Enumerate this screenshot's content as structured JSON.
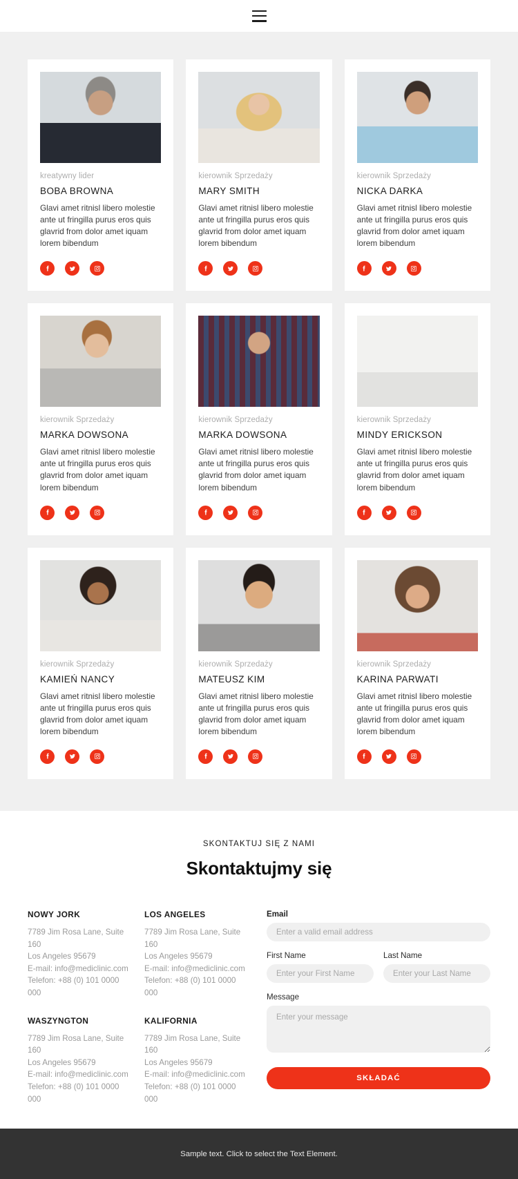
{
  "header": {
    "menu_icon": "hamburger-icon"
  },
  "team": {
    "members": [
      {
        "role": "kreatywny lider",
        "name": "BOBA BROWNA",
        "desc": "Glavi amet ritnisl libero molestie ante ut fringilla purus eros quis glavrid from dolor amet iquam lorem bibendum",
        "photo": "man-gray-hair-suit"
      },
      {
        "role": "kierownik Sprzedaży",
        "name": "MARY SMITH",
        "desc": "Glavi amet ritnisl libero molestie ante ut fringilla purus eros quis glavrid from dolor amet iquam lorem bibendum",
        "photo": "blonde-woman-smiling"
      },
      {
        "role": "kierownik Sprzedaży",
        "name": "NICKA DARKA",
        "desc": "Glavi amet ritnisl libero molestie ante ut fringilla purus eros quis glavrid from dolor amet iquam lorem bibendum",
        "photo": "bearded-man-blue-shirt"
      },
      {
        "role": "kierownik Sprzedaży",
        "name": "MARKA DOWSONA",
        "desc": "Glavi amet ritnisl libero molestie ante ut fringilla purus eros quis glavrid from dolor amet iquam lorem bibendum",
        "photo": "young-man-gray-hoodie"
      },
      {
        "role": "kierownik Sprzedaży",
        "name": "MARKA DOWSONA",
        "desc": "Glavi amet ritnisl libero molestie ante ut fringilla purus eros quis glavrid from dolor amet iquam lorem bibendum",
        "photo": "man-striped-shirt"
      },
      {
        "role": "kierownik Sprzedaży",
        "name": "MINDY ERICKSON",
        "desc": "Glavi amet ritnisl libero molestie ante ut fringilla purus eros quis glavrid from dolor amet iquam lorem bibendum",
        "photo": "woman-at-desk-office"
      },
      {
        "role": "kierownik Sprzedaży",
        "name": "KAMIEŃ NANCY",
        "desc": "Glavi amet ritnisl libero molestie ante ut fringilla purus eros quis glavrid from dolor amet iquam lorem bibendum",
        "photo": "curly-hair-woman-glasses"
      },
      {
        "role": "kierownik Sprzedaży",
        "name": "MATEUSZ KIM",
        "desc": "Glavi amet ritnisl libero molestie ante ut fringilla purus eros quis glavrid from dolor amet iquam lorem bibendum",
        "photo": "laughing-man-gray-shirt"
      },
      {
        "role": "kierownik Sprzedaży",
        "name": "KARINA PARWATI",
        "desc": "Glavi amet ritnisl libero molestie ante ut fringilla purus eros quis glavrid from dolor amet iquam lorem bibendum",
        "photo": "freckled-woman-brown-hair"
      }
    ],
    "social_labels": {
      "facebook": "facebook-icon",
      "twitter": "twitter-icon",
      "instagram": "instagram-icon"
    }
  },
  "contact": {
    "eyebrow": "SKONTAKTUJ SIĘ Z NAMI",
    "title": "Skontaktujmy się",
    "offices": [
      {
        "city": "NOWY JORK",
        "street": "7789 Jim Rosa Lane, Suite 160",
        "city_zip": "Los Angeles 95679",
        "email": "E-mail: info@mediclinic.com",
        "phone": "Telefon: +88 (0) 101 0000 000"
      },
      {
        "city": "LOS ANGELES",
        "street": "7789 Jim Rosa Lane, Suite 160",
        "city_zip": "Los Angeles 95679",
        "email": "E-mail: info@mediclinic.com",
        "phone": "Telefon: +88 (0) 101 0000 000"
      },
      {
        "city": "WASZYNGTON",
        "street": "7789 Jim Rosa Lane, Suite 160",
        "city_zip": "Los Angeles 95679",
        "email": "E-mail: info@mediclinic.com",
        "phone": "Telefon: +88 (0) 101 0000 000"
      },
      {
        "city": "KALIFORNIA",
        "street": "7789 Jim Rosa Lane, Suite 160",
        "city_zip": "Los Angeles 95679",
        "email": "E-mail: info@mediclinic.com",
        "phone": "Telefon: +88 (0) 101 0000 000"
      }
    ],
    "form": {
      "email_label": "Email",
      "email_placeholder": "Enter a valid email address",
      "email_value": "",
      "first_name_label": "First Name",
      "first_name_placeholder": "Enter your First Name",
      "first_name_value": "",
      "last_name_label": "Last Name",
      "last_name_placeholder": "Enter your Last Name",
      "last_name_value": "",
      "message_label": "Message",
      "message_placeholder": "Enter your message",
      "message_value": "",
      "submit_label": "SKŁADAĆ"
    }
  },
  "footer": {
    "text": "Sample text. Click to select the Text Element."
  },
  "colors": {
    "accent": "#ee3219",
    "page_bg": "#f0f0f0",
    "card_bg": "#ffffff",
    "footer_bg": "#333333"
  }
}
